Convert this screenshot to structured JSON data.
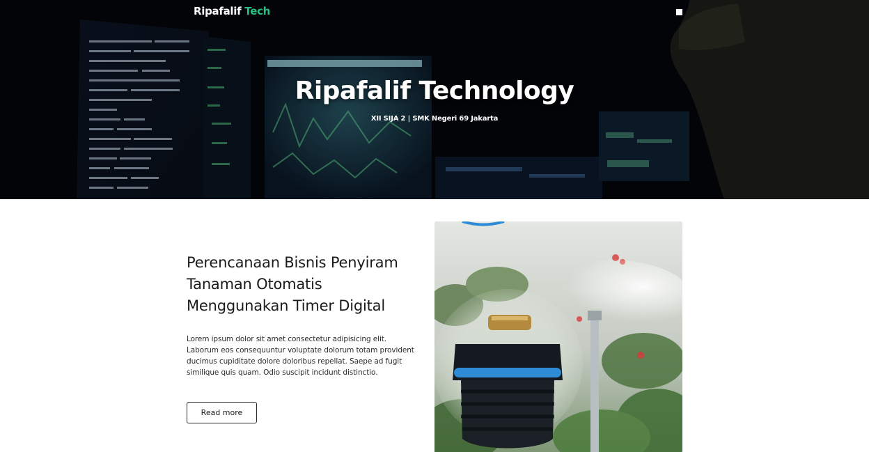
{
  "navbar": {
    "brand_main": "Ripafalif",
    "brand_accent": "Tech",
    "menu_icon": "square-menu-icon"
  },
  "hero": {
    "title": "Ripafalif Technology",
    "subtitle": "XII SIJA 2 | SMK Negeri 69 Jakarta",
    "background": "dark-computer-monitors-code-image"
  },
  "article": {
    "title": "Perencanaan Bisnis Penyiram Tanaman Otomatis Menggunakan Timer Digital",
    "body": "Lorem ipsum dolor sit amet consectetur adipisicing elit. Laborum eos consequuntur voluptate dolorum totam provident ducimus cupiditate dolore doloribus repellat. Saepe ad fugit similique quis quam. Odio suscipit incidunt distinctio.",
    "read_more_label": "Read more",
    "image": "garden-sprinkler-nozzle-image"
  },
  "colors": {
    "brand_accent": "#2bbf86",
    "hero_bg": "#05070d",
    "text_dark": "#1b1b1b"
  }
}
